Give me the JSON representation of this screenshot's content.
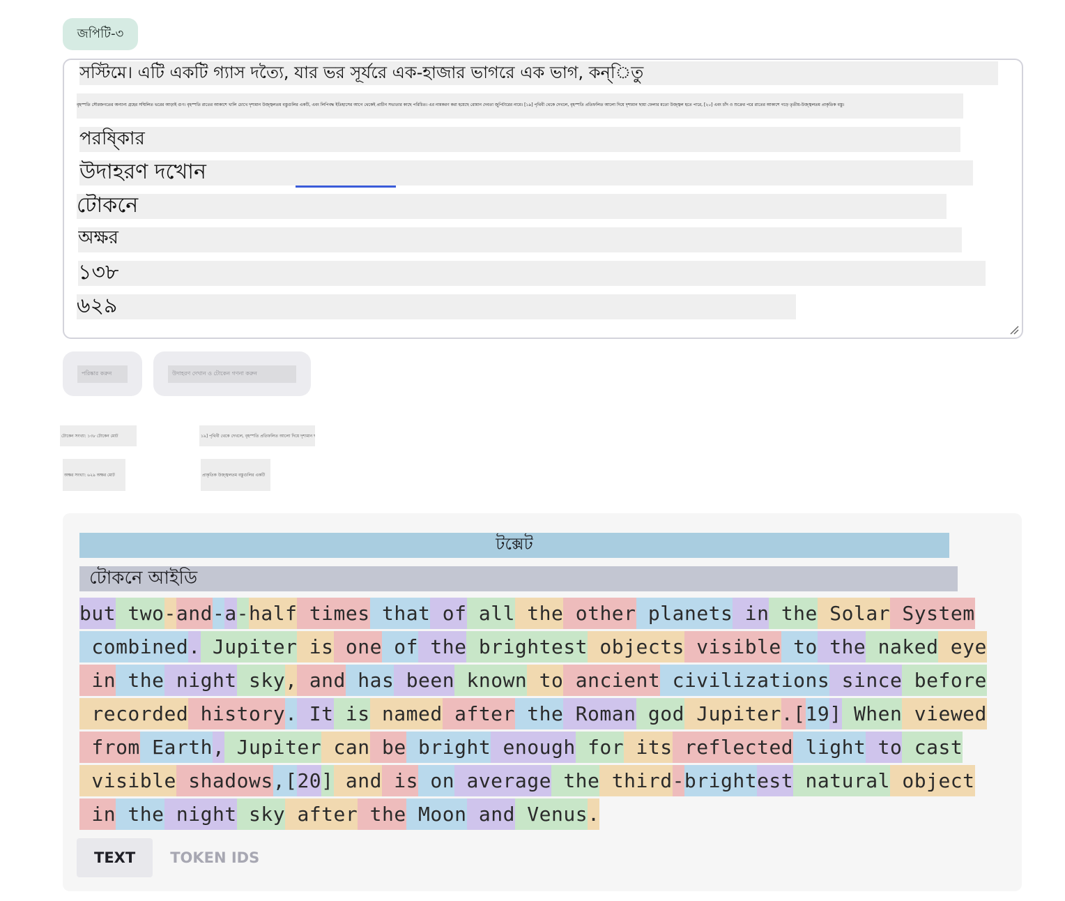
{
  "model_label": "জপিটি-৩",
  "textarea": {
    "line1": "সস্টিমে। এটি একটি গ্যাস দত্যৈ, যার ভর সূর্যরে এক-হাজার ভাগরে এক ভাগ, কন্িতু",
    "line2": "বৃহস্পতি সৌরজগতের অন্যান্য গ্রহের সম্মিলিত ভরের আড়াই গুণ। বৃহস্পতি রাতের আকাশে খালি চোখে দৃশ্যমান উজ্জ্বলতম বস্তুগুলির একটি, এবং লিপিবদ্ধ ইতিহাসের আগে থেকেই প্রাচীন সভ্যতার কাছে পরিচিত। এর নামকরণ করা হয়েছে রোমান দেবতা জুপিটারের নামে। [১৯] পৃথিবী থেকে দেখলে, বৃহস্পতি প্রতিফলিত আলো দিয়ে দৃশ্যমান ছায়া ফেলার মতো উজ্জ্বল হতে পারে, [২০] এবং চাঁদ ও শুক্রের পরে রাতের আকাশে গড়ে তৃতীয়-উজ্জ্বলতম প্রাকৃতিক বস্তু।",
    "line3": "পরষি্কার",
    "line4": "উদাহরণ দখোন",
    "line5": "টোকনে",
    "line6": "অক্ষর",
    "line7": "১৩৮",
    "line8": "৬২৯"
  },
  "buttons": {
    "clear": "পরিষ্কার করুন",
    "show_example": "উদাহরণ দেখান ও টোকেন গণনা করুন"
  },
  "stats": {
    "tokens_label": "টোকেন সংখ্যা: ১৩৮ টোকেন মোট",
    "tokens_text": "১৯] পৃথিবী থেকে দেখলে, বৃহস্পতি প্রতিফলিত আলো দিয়ে দৃশ্যমান ছায়া",
    "chars_label": "অক্ষর সংখ্যা: ৬২৯ অক্ষর মোট",
    "chars_text": "প্রাকৃতিক উজ্জ্বলতম বস্তুগুলির একটি"
  },
  "panel": {
    "text_header": "টক্সেট",
    "ids_header": "টোকনে আইডি",
    "tokens": [
      "but",
      " two",
      "-",
      "and",
      "-",
      "a",
      "-",
      "half",
      " times",
      " that",
      " of",
      " all",
      " the",
      " other",
      " planets",
      " in",
      " the",
      " Solar",
      " System",
      " combined",
      ".",
      " Jupiter",
      " is",
      " one",
      " of",
      " the",
      " brightest",
      " objects",
      " visible",
      " to",
      " the",
      " naked",
      " eye",
      " in",
      " the",
      " night",
      " sky",
      ",",
      " and",
      " has",
      " been",
      " known",
      " to",
      " ancient",
      " civilizations",
      " since",
      " before",
      " recorded",
      " history",
      ".",
      " It",
      " is",
      " named",
      " after",
      " the",
      " Roman",
      " god",
      " Jupiter",
      ".[",
      "19",
      "]",
      " When",
      " viewed",
      " from",
      " Earth",
      ",",
      " Jupiter",
      " can",
      " be",
      " bright",
      " enough",
      " for",
      " its",
      " reflected",
      " light",
      " to",
      " cast",
      " visible",
      " shadows",
      ",[",
      "20",
      "]",
      " and",
      " is",
      " on",
      " average",
      " the",
      " third",
      "-",
      "bright",
      "est",
      " natural",
      " object",
      " in",
      " the",
      " night",
      " sky",
      " after",
      " the",
      " Moon",
      " and",
      " Venus",
      "."
    ],
    "tab_text": "TEXT",
    "tab_ids": "TOKEN IDS"
  },
  "colors": {
    "token_palette": [
      "#cfc4ec",
      "#c8e6c8",
      "#f1d9b0",
      "#eebcbc",
      "#b9d9ec"
    ],
    "accent": "#3a5bd9"
  }
}
